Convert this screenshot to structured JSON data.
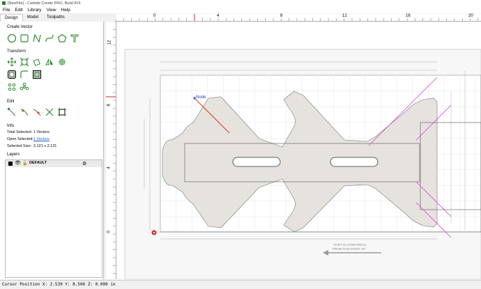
{
  "window": {
    "title": "[NewFile] - Carbide Create PRO, Build 815"
  },
  "menu": [
    "File",
    "Edit",
    "Library",
    "View",
    "Help"
  ],
  "tabs": [
    "Design",
    "Model",
    "Toolpaths"
  ],
  "sections": {
    "create_vector": "Create Vector",
    "transform": "Transform",
    "edit": "Edit",
    "info": "Info",
    "layers": "Layers"
  },
  "info": {
    "total_label": "Total Selected:",
    "total_value": "1 Vectors",
    "open_label": "Open Selected:",
    "open_value": "1 Vectors",
    "size_label": "Selected Size:",
    "size_value": "2.121 x 2.121"
  },
  "layer": {
    "name": "DEFAULT",
    "color": "#000000"
  },
  "ruler_top": [
    "0",
    "4",
    "8",
    "12",
    "16",
    "20"
  ],
  "ruler_left": [
    "12",
    "8",
    "4",
    "0"
  ],
  "canvas": {
    "node_label": "Node",
    "note_line1": "PART IS SYMETRICAL",
    "note_line2": "FROM THIS POINT UP"
  },
  "status": {
    "cursor": "Cursor Position X: 2.539 Y: 8.506 Z: 0.000 in"
  },
  "colors": {
    "accent": "#2e8b2e",
    "selection": "#e040e0",
    "part_fill": "#e6e3de",
    "node_line": "#e03a1a"
  }
}
